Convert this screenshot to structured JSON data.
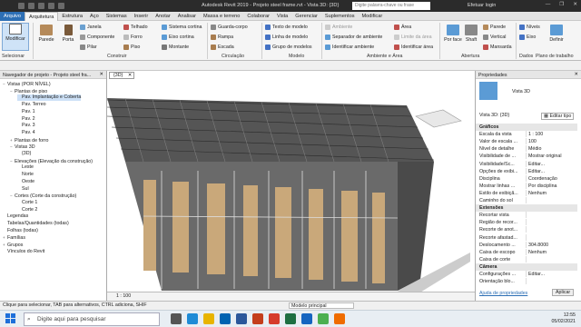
{
  "titlebar": {
    "title": "Autodesk Revit 2019 - Projeto steel frame.rvt - Vista 3D: {3D}",
    "search_placeholder": "Digite palavra-chave ou frase",
    "login": "Efetuar login"
  },
  "tabs": [
    "Arquivo",
    "Arquitetura",
    "Estrutura",
    "Aço",
    "Sistemas",
    "Inserir",
    "Anotar",
    "Analisar",
    "Massa e terreno",
    "Colaborar",
    "Vista",
    "Gerenciar",
    "Suplementos",
    "Modificar"
  ],
  "ribbon": {
    "modify": "Modificar",
    "wall": "Parede",
    "door": "Porta",
    "window": "Janela",
    "component": "Componente",
    "column": "Pilar",
    "roof": "Telhado",
    "ceiling": "Forro",
    "floor": "Piso",
    "curtain_system": "Sistema cortina",
    "curtain_grid": "Eixo cortina",
    "mullion": "Montante",
    "railing": "Guarda-corpo",
    "ramp": "Rampa",
    "stair": "Escada",
    "model_text": "Texto de modelo",
    "model_line": "Linha de modelo",
    "model_group": "Grupo de modelos",
    "room": "Ambiente",
    "room_separator": "Separador de ambiente",
    "tag_room": "Identificar ambiente",
    "area": "Área",
    "area_boundary": "Limite da área",
    "tag_area": "Identificar área",
    "by_face": "Por face",
    "shaft": "Shaft",
    "wall_opening": "Parede",
    "vertical": "Vertical",
    "dormer": "Mansarda",
    "levels": "Níveis",
    "grid": "Eixo",
    "set": "Definir",
    "groups": {
      "select": "Selecionar",
      "build": "Construir",
      "circulation": "Circulação",
      "model": "Modelo",
      "room_area": "Ambiente e Área",
      "opening": "Abertura",
      "datum": "Dados",
      "work_plane": "Plano de trabalho"
    }
  },
  "browser": {
    "title": "Navegador de projeto - Projeto steel fra...",
    "items": [
      {
        "label": "Vistas (POR NÍVEL)",
        "level": 0,
        "toggle": "−"
      },
      {
        "label": "Plantas de piso",
        "level": 1,
        "toggle": "−"
      },
      {
        "label": "Pav. Implantação e Coberta",
        "level": 2,
        "toggle": "",
        "selected": true
      },
      {
        "label": "Pav. Terreo",
        "level": 2,
        "toggle": ""
      },
      {
        "label": "Pav. 1",
        "level": 2,
        "toggle": ""
      },
      {
        "label": "Pav. 2",
        "level": 2,
        "toggle": ""
      },
      {
        "label": "Pav. 3",
        "level": 2,
        "toggle": ""
      },
      {
        "label": "Pav. 4",
        "level": 2,
        "toggle": ""
      },
      {
        "label": "Plantas de forro",
        "level": 1,
        "toggle": "+"
      },
      {
        "label": "Vistas 3D",
        "level": 1,
        "toggle": "−"
      },
      {
        "label": "{3D}",
        "level": 2,
        "toggle": ""
      },
      {
        "label": "Elevações (Elevação da construção)",
        "level": 1,
        "toggle": "−"
      },
      {
        "label": "Leste",
        "level": 2,
        "toggle": ""
      },
      {
        "label": "Norte",
        "level": 2,
        "toggle": ""
      },
      {
        "label": "Oeste",
        "level": 2,
        "toggle": ""
      },
      {
        "label": "Sul",
        "level": 2,
        "toggle": ""
      },
      {
        "label": "Cortes (Corte da construção)",
        "level": 1,
        "toggle": "−"
      },
      {
        "label": "Corte 1",
        "level": 2,
        "toggle": ""
      },
      {
        "label": "Corte 2",
        "level": 2,
        "toggle": ""
      },
      {
        "label": "Legendas",
        "level": 0,
        "toggle": ""
      },
      {
        "label": "Tabelas/Quantidades (todas)",
        "level": 0,
        "toggle": ""
      },
      {
        "label": "Folhas (todas)",
        "level": 0,
        "toggle": ""
      },
      {
        "label": "Famílias",
        "level": 0,
        "toggle": "+"
      },
      {
        "label": "Grupos",
        "level": 0,
        "toggle": "+"
      },
      {
        "label": "Vínculos do Revit",
        "level": 0,
        "toggle": ""
      }
    ]
  },
  "view": {
    "tab": "{3D}",
    "scale": "1 : 100"
  },
  "properties": {
    "title": "Propriedades",
    "type_name": "Vista 3D",
    "selector": "Vista 3D: {3D}",
    "edit_type": "Editar tipo",
    "rows": [
      {
        "k": "Gráficos",
        "v": "",
        "section": true
      },
      {
        "k": "Escala da vista",
        "v": "1 : 100"
      },
      {
        "k": "Valor de escala ...",
        "v": "100"
      },
      {
        "k": "Nível de detalhe",
        "v": "Médio"
      },
      {
        "k": "Visibilidade de ...",
        "v": "Mostrar original"
      },
      {
        "k": "Visibilidade/Sc...",
        "v": "Editar..."
      },
      {
        "k": "Opções de exibi...",
        "v": "Editar..."
      },
      {
        "k": "Disciplina",
        "v": "Coordenação"
      },
      {
        "k": "Mostrar linhas ...",
        "v": "Por disciplina"
      },
      {
        "k": "Estilo de exibiçã...",
        "v": "Nenhum"
      },
      {
        "k": "Caminho do sol",
        "v": ""
      },
      {
        "k": "Extensões",
        "v": "",
        "section": true
      },
      {
        "k": "Recortar vista",
        "v": ""
      },
      {
        "k": "Região de recor...",
        "v": ""
      },
      {
        "k": "Recorte de anot...",
        "v": ""
      },
      {
        "k": "Recorte afastad...",
        "v": ""
      },
      {
        "k": "Deslocamento ...",
        "v": "304.8000"
      },
      {
        "k": "Caixa de escopo",
        "v": "Nenhum"
      },
      {
        "k": "Caixa de corte",
        "v": ""
      },
      {
        "k": "Câmera",
        "v": "",
        "section": true
      },
      {
        "k": "Configurações ...",
        "v": "Editar..."
      },
      {
        "k": "Orientação blo...",
        "v": ""
      }
    ],
    "help": "Ajuda de propriedades",
    "apply": "Aplicar"
  },
  "statusbar": {
    "hint": "Clique para selecionar, TAB para alternativos, CTRL adiciona, SHIF",
    "model": "Modelo principal"
  },
  "taskbar": {
    "search": "Digite aqui para pesquisar",
    "time": "12:55",
    "date": "05/02/2021"
  }
}
